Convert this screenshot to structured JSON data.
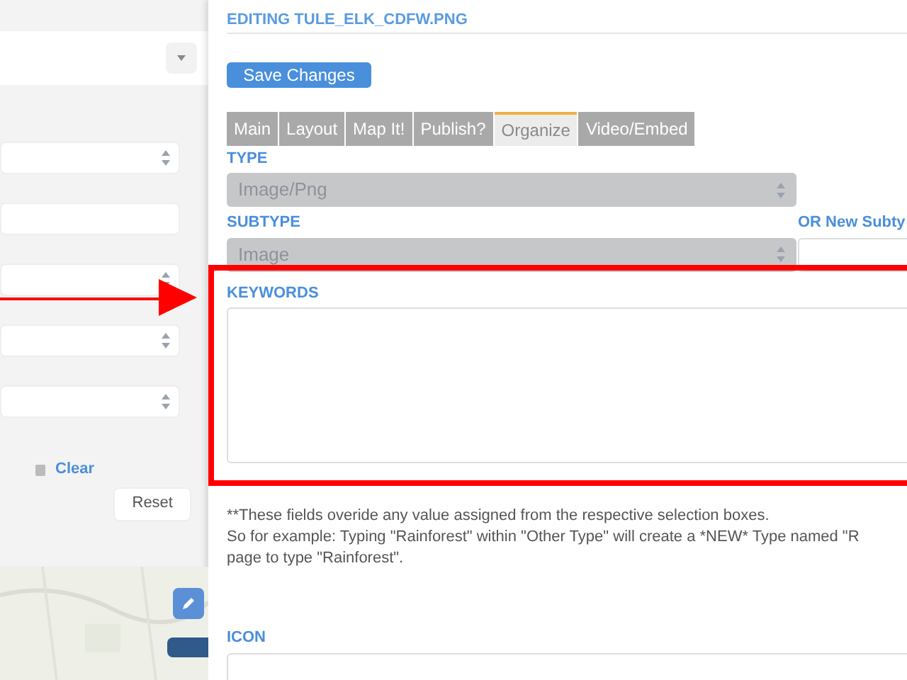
{
  "background_panel": {
    "clear_link": "Clear",
    "reset_button": "Reset"
  },
  "dialog": {
    "title": "EDITING TULE_ELK_CDFW.PNG",
    "save_button": "Save Changes",
    "tabs": [
      {
        "label": "Main",
        "selected": false
      },
      {
        "label": "Layout",
        "selected": false
      },
      {
        "label": "Map It!",
        "selected": false
      },
      {
        "label": "Publish?",
        "selected": false
      },
      {
        "label": "Organize",
        "selected": true
      },
      {
        "label": "Video/Embed",
        "selected": false
      }
    ],
    "type": {
      "label": "TYPE",
      "value": "Image/Png",
      "disabled": true
    },
    "subtype": {
      "label": "SUBTYPE",
      "value": "Image",
      "disabled": true
    },
    "new_subtype": {
      "label": "OR New Subty"
    },
    "keywords": {
      "label": "KEYWORDS"
    },
    "note_lines": [
      "**These fields overide any value assigned from the respective selection boxes.",
      "So for example: Typing \"Rainforest\" within \"Other Type\" will create a *NEW* Type named \"R",
      "page to type \"Rainforest\"."
    ],
    "icon": {
      "label": "ICON"
    }
  }
}
